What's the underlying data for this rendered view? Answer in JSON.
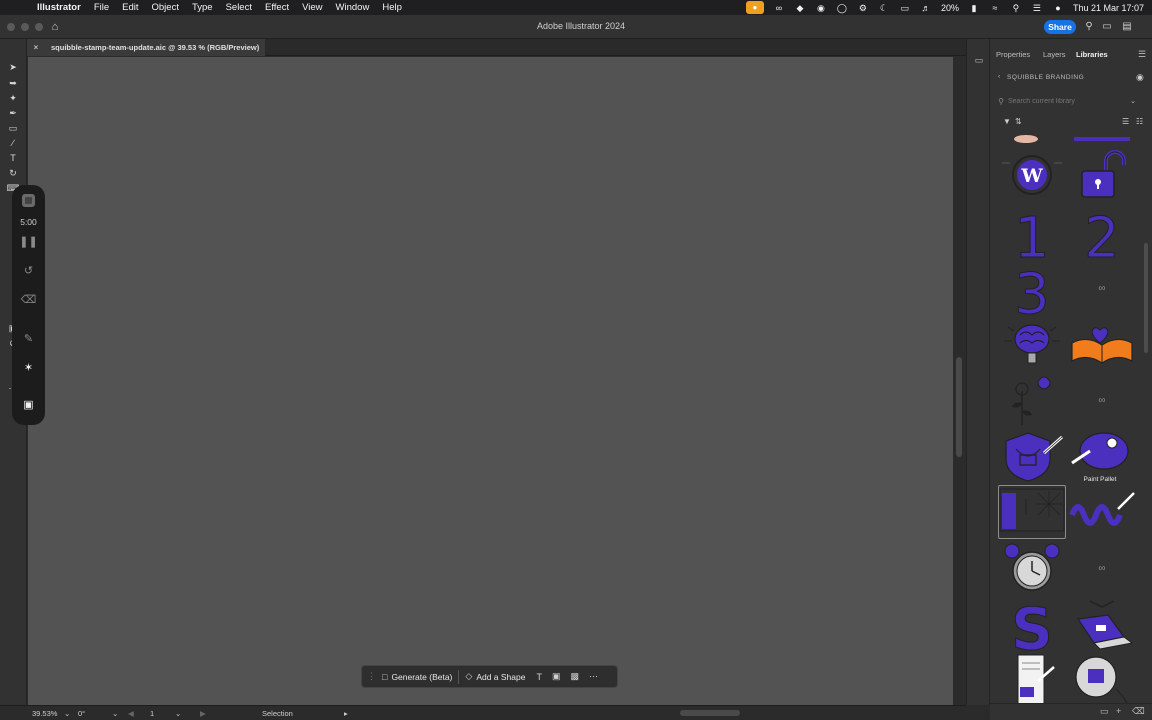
{
  "menubar": {
    "app_name": "Illustrator",
    "items": [
      "File",
      "Edit",
      "Object",
      "Type",
      "Select",
      "Effect",
      "View",
      "Window",
      "Help"
    ],
    "battery": "20%",
    "datetime": "Thu 21 Mar  17:07"
  },
  "titlebar": {
    "title": "Adobe Illustrator 2024",
    "share_label": "Share"
  },
  "document": {
    "tab_title": "squibble-stamp-team-update.aic @ 39.53 % (RGB/Preview)"
  },
  "timer": {
    "time": "5:00"
  },
  "contextual_bar": {
    "generate_label": "Generate (Beta)",
    "add_shape_label": "Add a Shape"
  },
  "statusbar": {
    "zoom": "39.53%",
    "rotation": "0°",
    "artboard": "1",
    "tool": "Selection"
  },
  "panel": {
    "tabs": [
      "Properties",
      "Layers",
      "Libraries"
    ],
    "active_tab": "Libraries",
    "library_name": "SQUIBBLE BRANDING",
    "search_placeholder": "Search current library",
    "hover_caption": "Paint Pallet"
  },
  "colors": {
    "accent_purple": "#4b2fbf",
    "share_blue": "#1473e6",
    "canvas": "#535353",
    "panel": "#323232",
    "book_orange": "#f07c1c"
  }
}
